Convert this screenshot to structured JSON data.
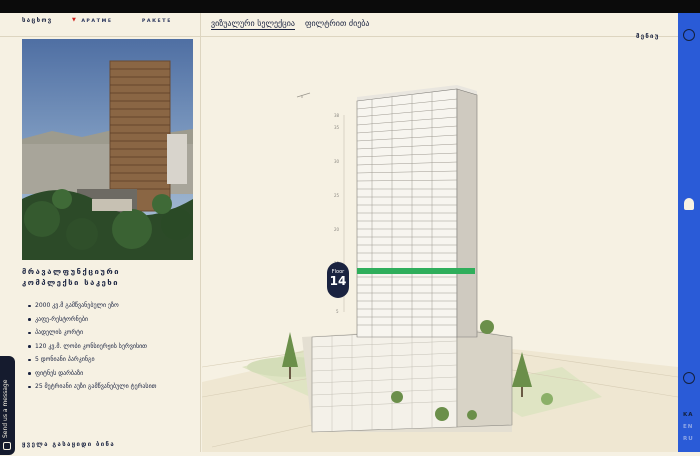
{
  "filters": {
    "living": "საცხოვ",
    "apart": "ᴀᴘᴀᴛᴍᴇ",
    "parking": "ᴘᴀᴋᴇᴛᴇ"
  },
  "tabs": [
    {
      "label": "ვიზუალური სელექცია"
    },
    {
      "label": "ფილტრით ძიება"
    }
  ],
  "menu_label": "მენიუ",
  "project": {
    "title_line1": "მრავალფუნქციური",
    "title_line2": "კომპლექსი საკეხი",
    "features": [
      "2000 კვ.მ გამწვანებული ეზო",
      "კაფე-რესტორნები",
      "პადელის კორტი",
      "120 კვ.მ. ლობი კონსიერჟის სერვისით",
      "5 დონიანი პარკინგი",
      "ფიტნეს დარბაზი",
      "25 მეტრიანი აუზი გამწვანებული ტერასით"
    ]
  },
  "send_message": "Send us a message",
  "all_sale_label": "ყველა გასაყიდი ბინა",
  "floor": {
    "label": "Floor",
    "number": "14"
  },
  "floor_scale": [
    "38",
    "35",
    "30",
    "25",
    "20",
    "15",
    "10",
    "5"
  ],
  "languages": [
    "KA",
    "EN",
    "RU"
  ],
  "colors": {
    "accent_blue": "#2a5bd7",
    "highlight_green": "#2fae5b",
    "navy": "#1a2340",
    "bg": "#f6f1e3"
  }
}
